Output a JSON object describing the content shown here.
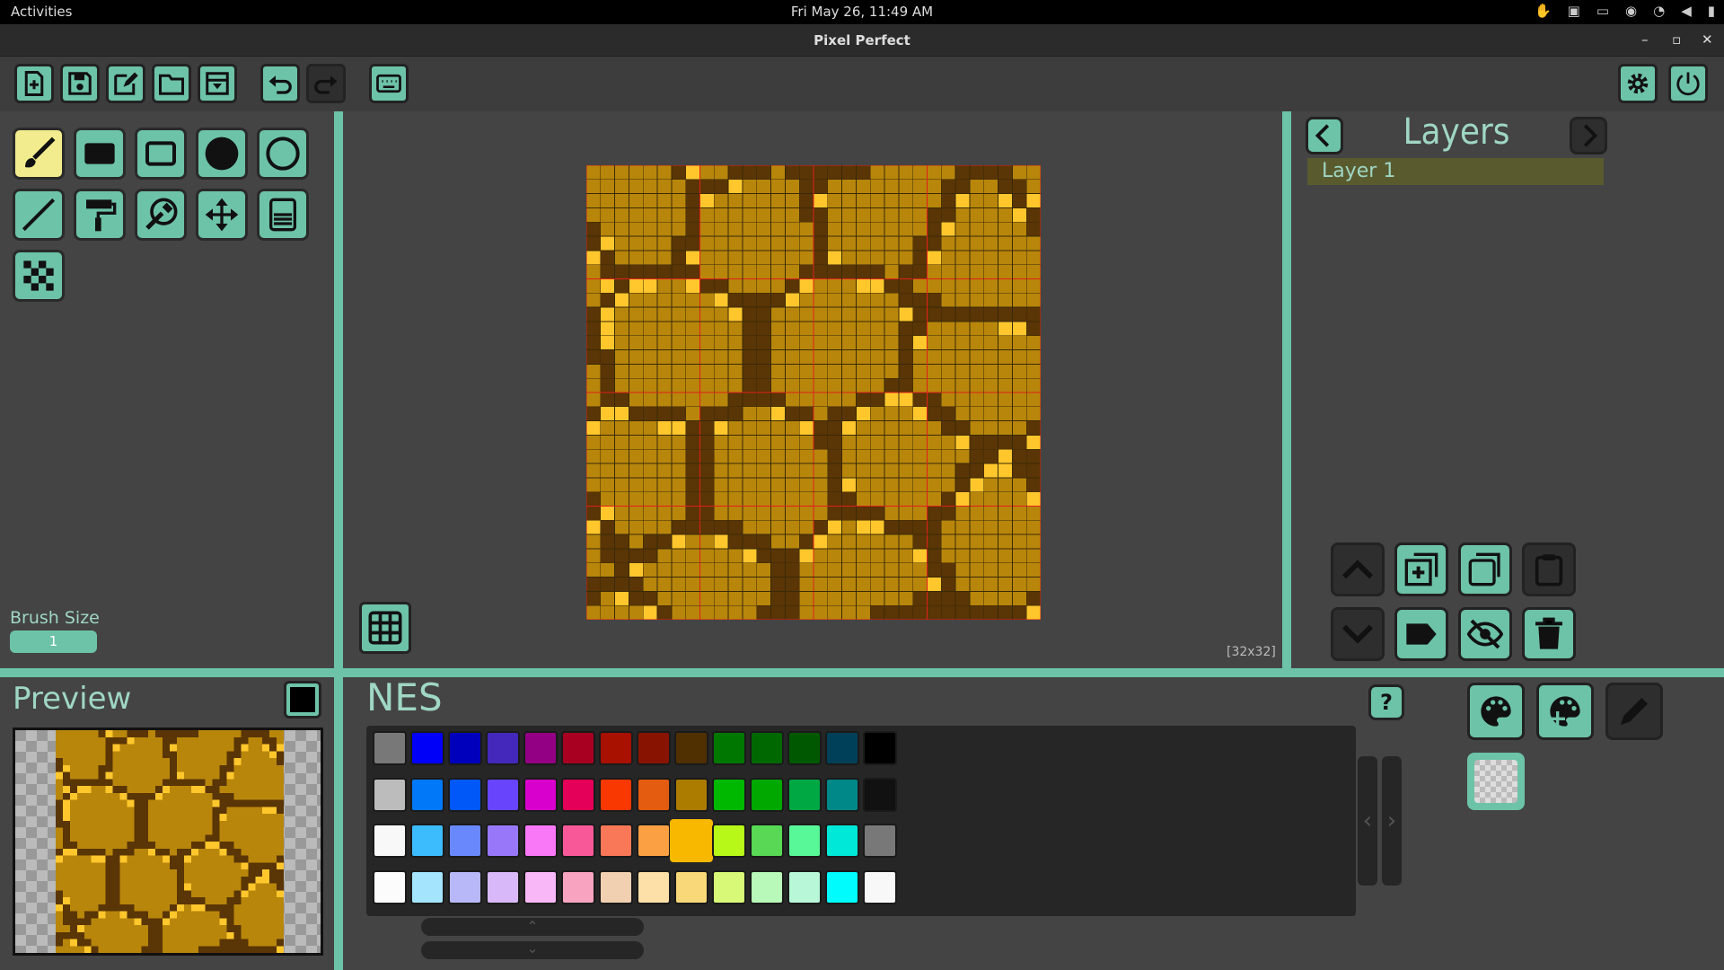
{
  "topbar": {
    "activities": "Activities",
    "clock": "Fri May 26, 11:49 AM"
  },
  "window": {
    "title": "Pixel Perfect"
  },
  "toolbar": {
    "buttons": [
      "new-file",
      "save",
      "edit",
      "open-folder",
      "import",
      "undo",
      "redo",
      "keyboard"
    ],
    "right": [
      "settings",
      "power"
    ]
  },
  "tools": [
    "brush",
    "filled-rectangle",
    "rectangle",
    "filled-circle",
    "circle",
    "line",
    "paint-roller",
    "color-picker",
    "move",
    "fill-bucket",
    "checker"
  ],
  "brush": {
    "label": "Brush Size",
    "value": "1"
  },
  "canvas": {
    "size_label": "[32x32]"
  },
  "layers": {
    "title": "Layers",
    "items": [
      "Layer 1"
    ]
  },
  "preview": {
    "title": "Preview"
  },
  "palette": {
    "name": "NES",
    "help": "?",
    "rows": [
      [
        "#787878",
        "#0000f8",
        "#0000bc",
        "#4428bc",
        "#940084",
        "#a80020",
        "#a81000",
        "#881400",
        "#503000",
        "#007800",
        "#006800",
        "#005800",
        "#004058",
        "#000000"
      ],
      [
        "#bcbcbc",
        "#0078f8",
        "#0058f8",
        "#6844fc",
        "#d800cc",
        "#e40058",
        "#f83800",
        "#e45c10",
        "#ac7c00",
        "#00b800",
        "#00a800",
        "#00a844",
        "#008888",
        "#111111"
      ],
      [
        "#f8f8f8",
        "#3cbcfc",
        "#6888fc",
        "#9878f8",
        "#f878f8",
        "#f85898",
        "#f87858",
        "#fca044",
        "#f8b800",
        "#b8f818",
        "#58d854",
        "#58f898",
        "#00e8d8",
        "#787878"
      ],
      [
        "#fcfcfc",
        "#a4e4fc",
        "#b8b8f8",
        "#d8b8f8",
        "#f8b8f8",
        "#f8a4c0",
        "#f0d0b0",
        "#fce0a8",
        "#f8d878",
        "#d8f878",
        "#b8f8b8",
        "#b8f8d8",
        "#00fcfc",
        "#f8f8f8"
      ]
    ],
    "selected": [
      2,
      8
    ]
  },
  "colors": {
    "accent": "#6dc3a8",
    "ground": "#b8860b",
    "crack": "#5a3505",
    "highlight": "#ffc72c",
    "gridline": "#e0201a"
  }
}
